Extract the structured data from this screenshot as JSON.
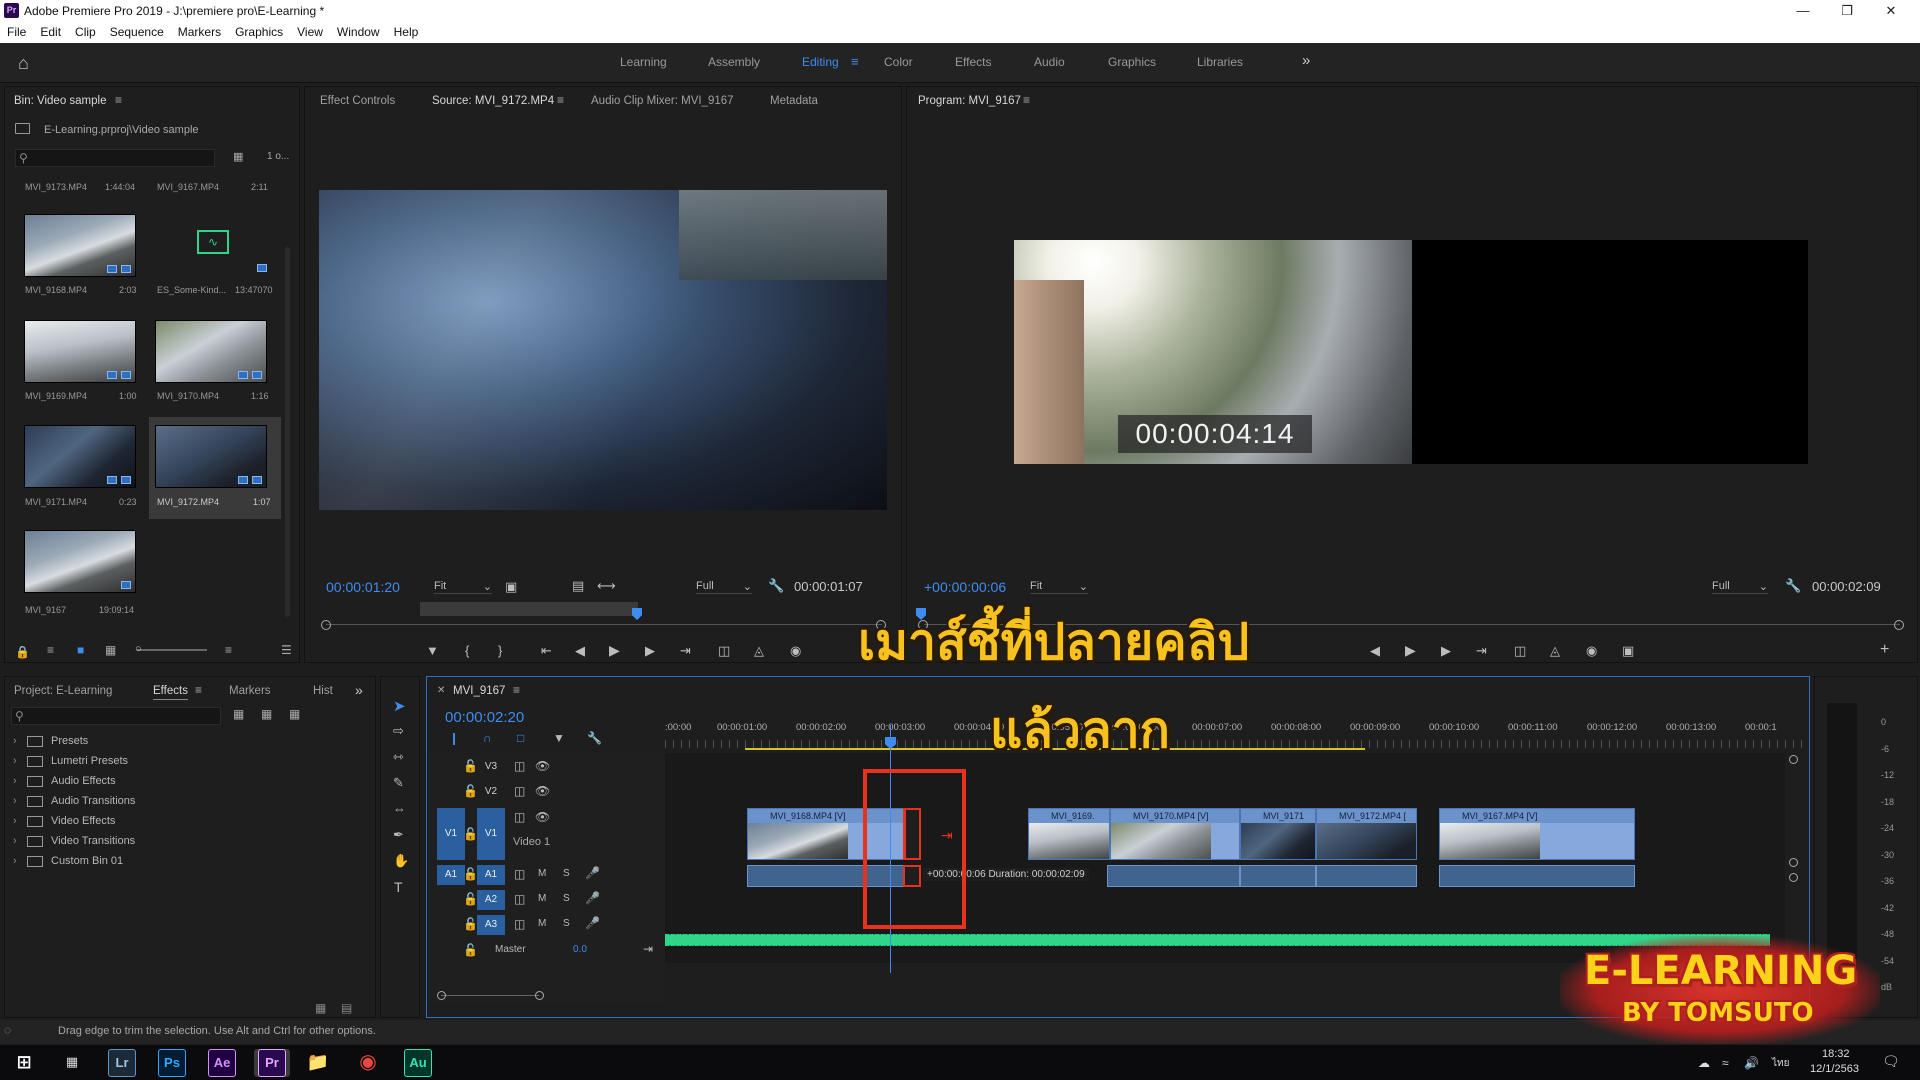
{
  "window": {
    "title": "Adobe Premiere Pro 2019 - J:\\premiere pro\\E-Learning *",
    "app_icon": "Pr"
  },
  "menu": [
    "File",
    "Edit",
    "Clip",
    "Sequence",
    "Markers",
    "Graphics",
    "View",
    "Window",
    "Help"
  ],
  "workspaces": [
    "Learning",
    "Assembly",
    "Editing",
    "Color",
    "Effects",
    "Audio",
    "Graphics",
    "Libraries"
  ],
  "bin": {
    "title": "Bin: Video sample",
    "path": "E-Learning.prproj\\Video sample",
    "count": "1 o...",
    "items": [
      {
        "name": "MVI_9173.MP4",
        "dur": "1:44:04"
      },
      {
        "name": "MVI_9167.MP4",
        "dur": "2:11"
      },
      {
        "name": "MVI_9168.MP4",
        "dur": "2:03"
      },
      {
        "name": "ES_Some-Kind...",
        "dur": "13:47070"
      },
      {
        "name": "MVI_9169.MP4",
        "dur": "1:00"
      },
      {
        "name": "MVI_9170.MP4",
        "dur": "1:16"
      },
      {
        "name": "MVI_9171.MP4",
        "dur": "0:23"
      },
      {
        "name": "MVI_9172.MP4",
        "dur": "1:07"
      },
      {
        "name": "MVI_9167",
        "dur": "19:09:14"
      }
    ]
  },
  "source": {
    "tabs": [
      "Effect Controls",
      "Source: MVI_9172.MP4",
      "Audio Clip Mixer: MVI_9167",
      "Metadata"
    ],
    "timecode": "00:00:01:20",
    "fit": "Fit",
    "full": "Full",
    "duration": "00:00:01:07"
  },
  "program": {
    "title": "Program: MVI_9167",
    "overlay_timecode": "00:00:04:14",
    "timecode": "+00:00:00:06",
    "fit": "Fit",
    "full": "Full",
    "duration": "00:00:02:09"
  },
  "project": {
    "tabs": [
      "Project: E-Learning",
      "Effects",
      "Markers",
      "Hist"
    ],
    "folders": [
      "Presets",
      "Lumetri Presets",
      "Audio Effects",
      "Audio Transitions",
      "Video Effects",
      "Video Transitions",
      "Custom Bin 01"
    ]
  },
  "timeline": {
    "sequence": "MVI_9167",
    "timecode": "00:00:02:20",
    "ruler": [
      ":00:00",
      "00:00:01:00",
      "00:00:02:00",
      "00:00:03:00",
      "00:00:04:00",
      "00:00:05:00",
      "00:00:06:00",
      "00:00:07:00",
      "00:00:08:00",
      "00:00:09:00",
      "00:00:10:00",
      "00:00:11:00",
      "00:00:12:00",
      "00:00:13:00",
      "00:00:1"
    ],
    "tracks": {
      "v3": "V3",
      "v2": "V2",
      "v1": "V1",
      "video1": "Video 1",
      "a1": "A1",
      "a2": "A2",
      "a3": "A3",
      "master": "Master",
      "master_val": "0.0",
      "m": "M",
      "s": "S"
    },
    "clips": [
      "MVI_9168.MP4 [V]",
      "MVI_9169.",
      "MVI_9170.MP4 [V]",
      "MVI_9171",
      "MVI_9172.MP4 [",
      "MVI_9167.MP4 [V]"
    ],
    "trim_tooltip": "+00:00:00:06 Duration: 00:00:02:09"
  },
  "meter": [
    "0",
    "-6",
    "-12",
    "-18",
    "-24",
    "-30",
    "-36",
    "-42",
    "-48",
    "-54",
    "dB"
  ],
  "status": "Drag edge to trim the selection. Use Alt and Ctrl for other options.",
  "overlay": {
    "line1": "เมาส์ชี้ที่ปลายคลิป",
    "line2": "แล้วลาก"
  },
  "logo": {
    "line1": "E-LEARNING",
    "line2": "BY TOMSUTO"
  },
  "taskbar": {
    "apps": [
      "Lr",
      "Ps",
      "Ae",
      "Pr",
      "Au"
    ],
    "lang": "ไทย",
    "time": "18:32",
    "date": "12/1/2563"
  },
  "colors": {
    "accent": "#3f8cf0",
    "clip": "#86a8dc",
    "audio_wave": "#2fd68a",
    "highlight": "#e8321e",
    "overlay_text": "#f7c21e"
  }
}
